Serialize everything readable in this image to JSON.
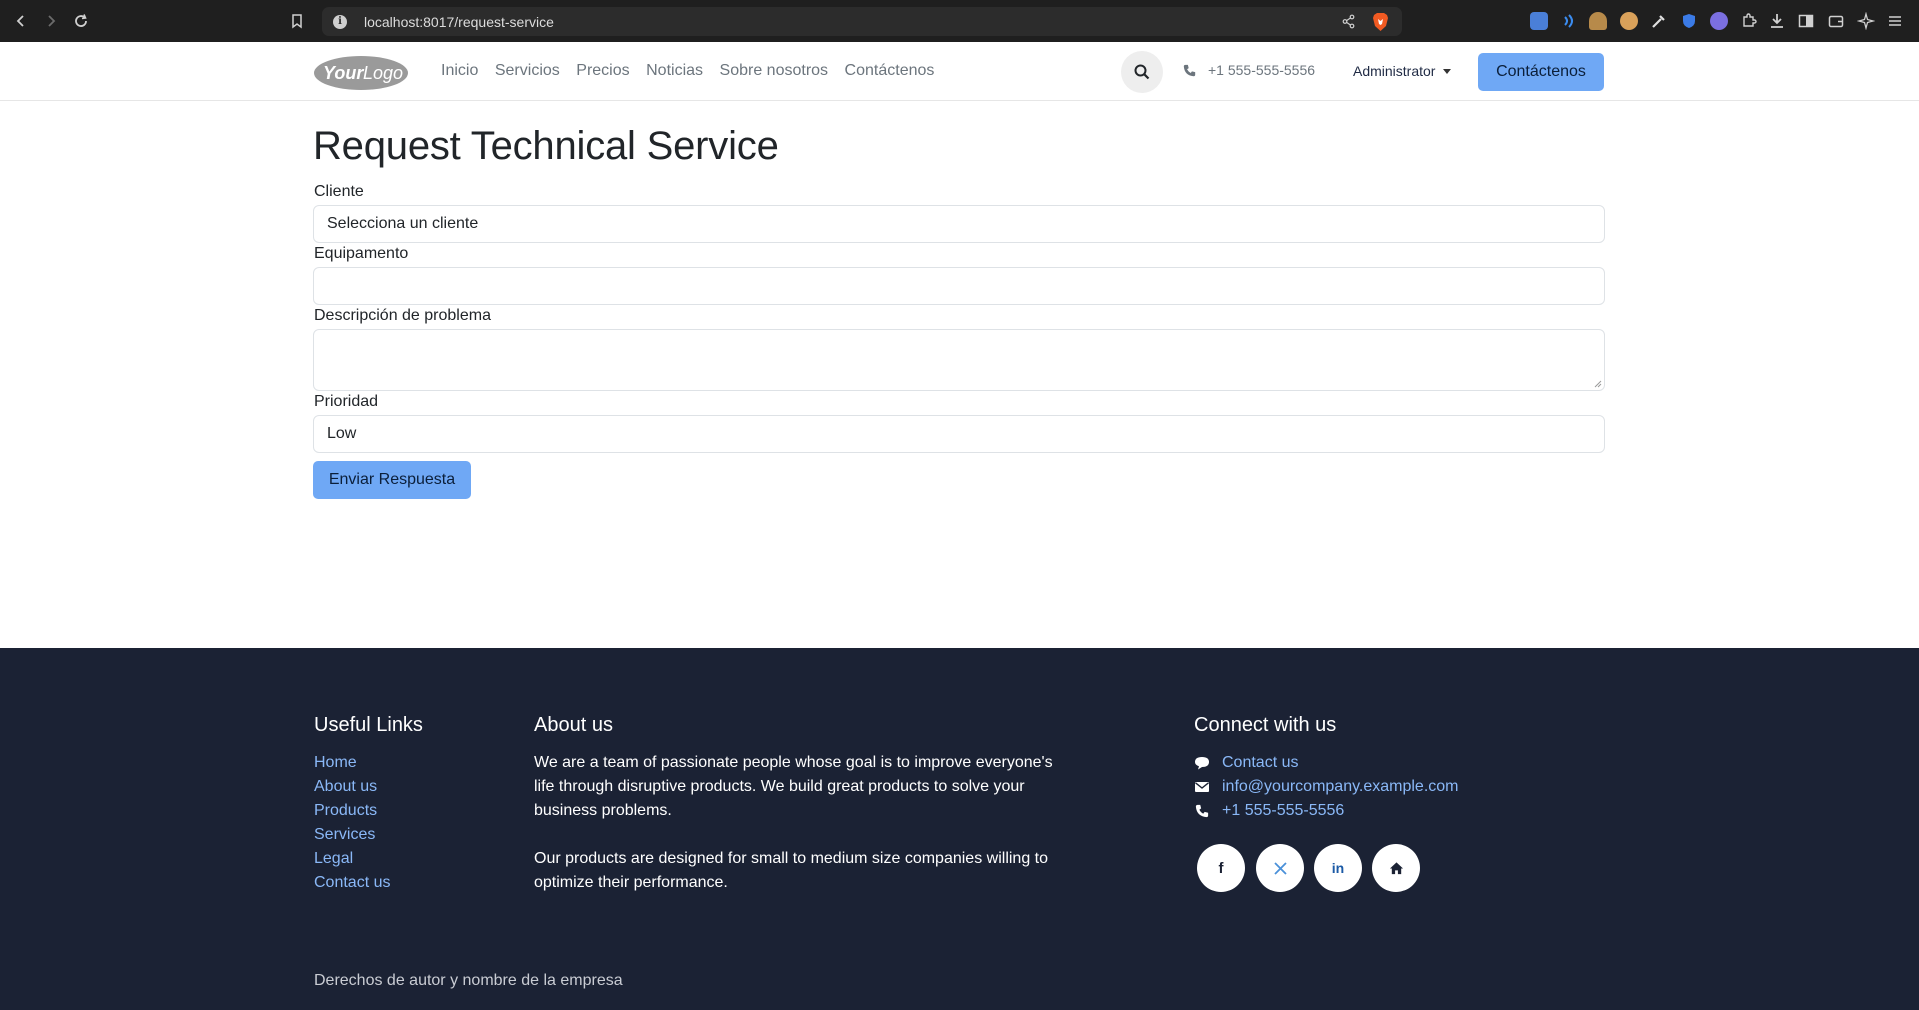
{
  "browser": {
    "url": "localhost:8017/request-service"
  },
  "header": {
    "logo_text": "YourLogo",
    "menu": [
      "Inicio",
      "Servicios",
      "Precios",
      "Noticias",
      "Sobre nosotros",
      "Contáctenos"
    ],
    "phone": "+1 555-555-5556",
    "user": "Administrator",
    "cta_label": "Contáctenos"
  },
  "form": {
    "title": "Request Technical Service",
    "client_label": "Cliente",
    "client_value": "Selecciona un cliente",
    "equipment_label": "Equipamento",
    "equipment_value": "",
    "description_label": "Descripción de problema",
    "description_value": "",
    "priority_label": "Prioridad",
    "priority_value": "Low",
    "submit_label": "Enviar Respuesta"
  },
  "footer": {
    "links_title": "Useful Links",
    "links": [
      "Home",
      "About us",
      "Products",
      "Services",
      "Legal",
      "Contact us"
    ],
    "about_title": "About us",
    "about_p1": "We are a team of passionate people whose goal is to improve everyone's life through disruptive products. We build great products to solve your business problems.",
    "about_p2": "Our products are designed for small to medium size companies willing to optimize their performance.",
    "connect_title": "Connect with us",
    "contact": [
      "Contact us",
      "info@yourcompany.example.com",
      "+1 555-555-5556"
    ],
    "social": [
      "facebook-icon",
      "x-icon",
      "linkedin-icon",
      "home-icon"
    ],
    "copyright": "Derechos de autor y nombre de la empresa"
  },
  "colors": {
    "accent": "#6fa8f5",
    "footer_bg": "#1b2234",
    "link": "#8ab8f7"
  }
}
